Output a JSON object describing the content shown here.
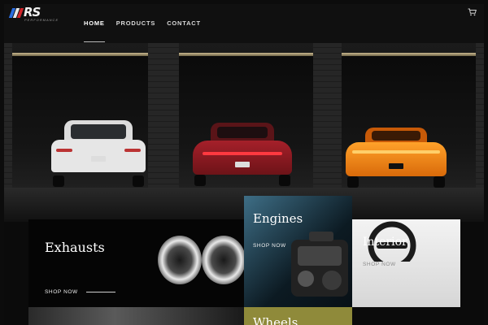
{
  "brand": {
    "name": "RS",
    "tagline": "PERFORMANCE"
  },
  "nav": {
    "items": [
      {
        "label": "HOME"
      },
      {
        "label": "PRODUCTS"
      },
      {
        "label": "CONTACT"
      }
    ]
  },
  "tiles": {
    "exhausts": {
      "title": "Exhausts",
      "cta": "SHOP NOW"
    },
    "engines": {
      "title": "Engines",
      "cta": "SHOP NOW"
    },
    "interior": {
      "title": "Interior",
      "cta": "SHOP NOW"
    },
    "wheels": {
      "title": "Wheels"
    }
  },
  "colors": {
    "accent_blue": "#2a6de0",
    "accent_red": "#d0242a",
    "wheels_bg": "#8f8a3a"
  },
  "icons": {
    "cart": "shopping-cart-icon"
  }
}
